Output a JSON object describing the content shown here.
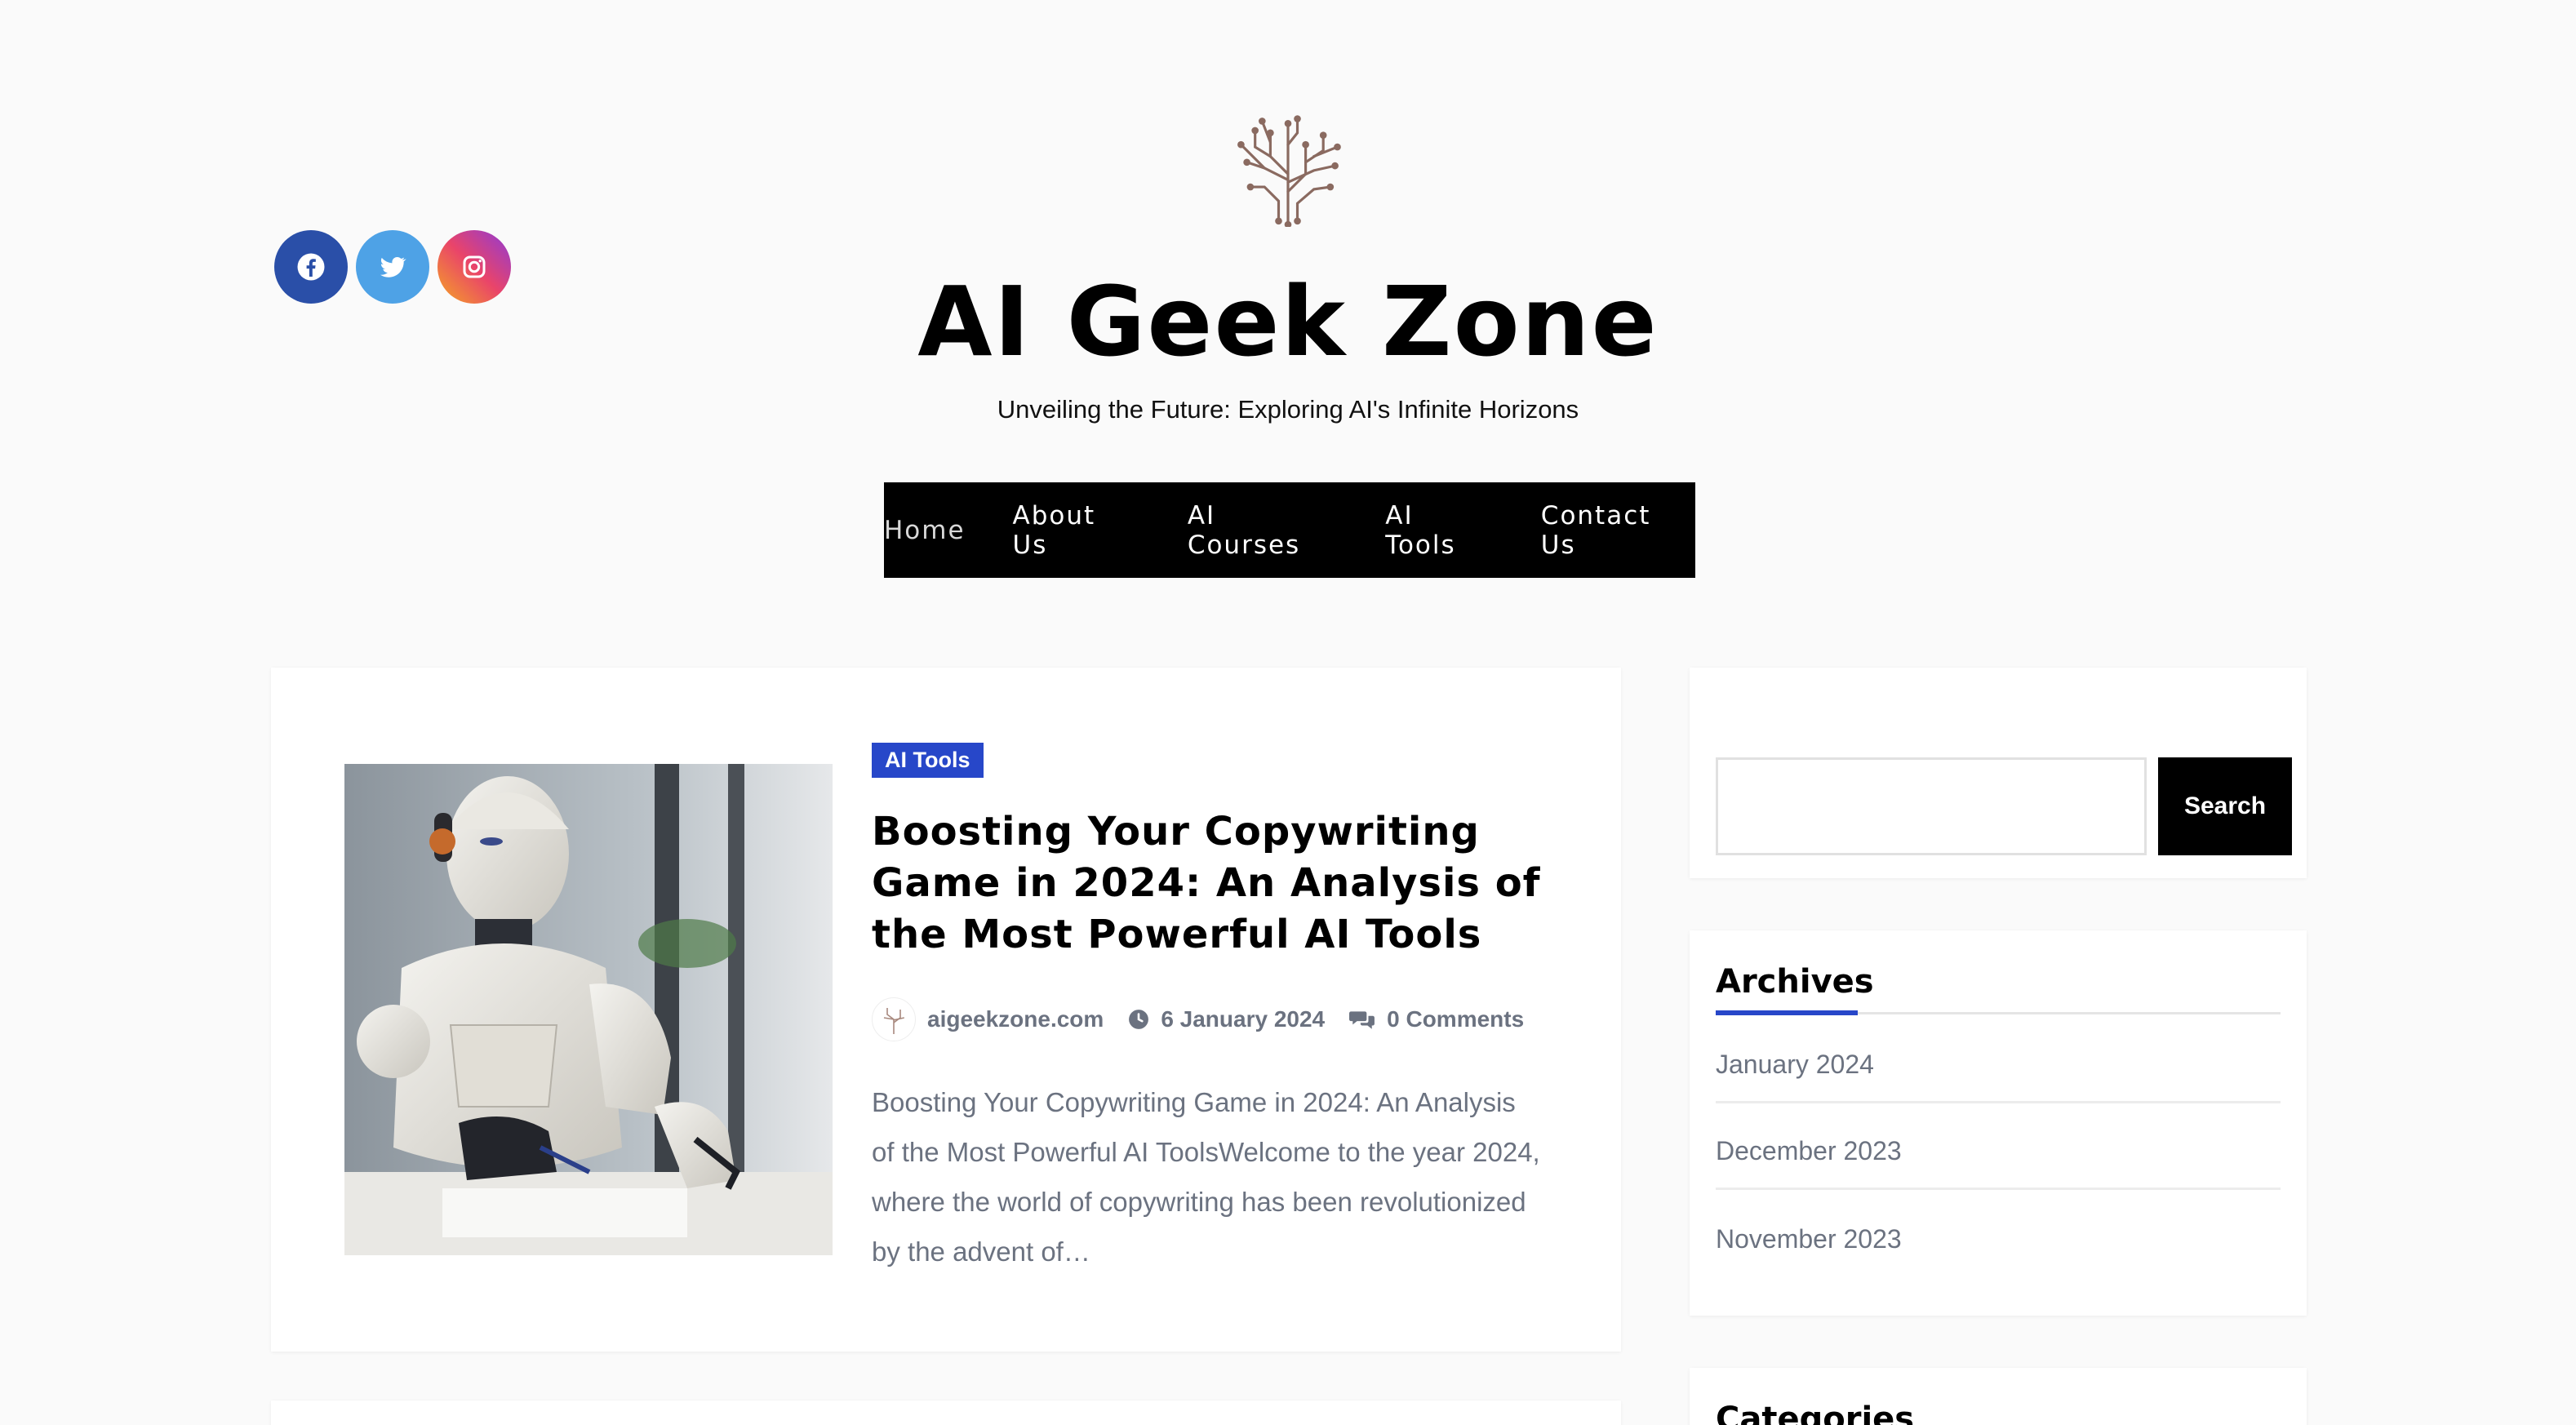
{
  "header": {
    "site_title": "AI Geek Zone",
    "tagline": "Unveiling the Future: Exploring AI's Infinite Horizons",
    "social": [
      {
        "name": "facebook",
        "icon": "facebook-icon",
        "color": "#2a4fa8"
      },
      {
        "name": "twitter",
        "icon": "twitter-icon",
        "color": "#4ea2e6"
      },
      {
        "name": "instagram",
        "icon": "instagram-icon",
        "color": "#e9446a"
      }
    ]
  },
  "nav": {
    "items": [
      {
        "label": "Home"
      },
      {
        "label": "About Us"
      },
      {
        "label": "AI Courses"
      },
      {
        "label": "AI Tools"
      },
      {
        "label": "Contact Us"
      }
    ]
  },
  "post": {
    "category": "AI Tools",
    "title": "Boosting Your Copywriting Game in 2024: An Analysis of the Most Powerful AI Tools",
    "author": "aigeekzone.com",
    "date": "6 January 2024",
    "comments": "0 Comments",
    "excerpt": "Boosting Your Copywriting Game in 2024: An Analysis of the Most Powerful AI ToolsWelcome to the year 2024, where the world of copywriting has been revolutionized by the advent of…"
  },
  "sidebar": {
    "search": {
      "button_label": "Search",
      "placeholder": ""
    },
    "archives": {
      "title": "Archives",
      "items": [
        "January 2024",
        "December 2023",
        "November 2023"
      ]
    },
    "categories": {
      "title": "Categories"
    }
  },
  "colors": {
    "accent": "#2747c9",
    "nav_bg": "#000000",
    "muted_text": "#6b7280"
  }
}
